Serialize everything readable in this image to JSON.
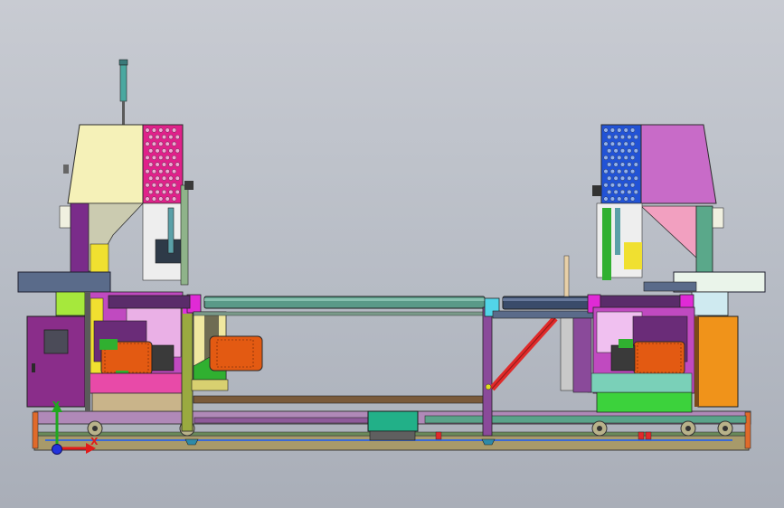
{
  "scene": {
    "kind": "cad-model-front-view",
    "background": "#bcc0c8"
  },
  "triad": {
    "x_label": "X",
    "y_label": "Y",
    "x_color": "#e21a1a",
    "y_color": "#1fa81f",
    "z_color": "#2233dd"
  },
  "palette": {
    "hood_cream": "#f5f1b8",
    "hood_magenta": "#e0218a",
    "hood_blue": "#2253d6",
    "hood_violet": "#c86bc8",
    "cabinet_purple": "#8a2d8a",
    "motor_orange": "#e35a12",
    "cabinet_orange": "#f0931a",
    "roller_teal": "#5a9a88",
    "beam_steel": "#5a6b8a",
    "frame_green": "#3cd23c",
    "lime": "#a6e83c",
    "tan": "#c9b48a",
    "dark_purple": "#4a2b52"
  }
}
